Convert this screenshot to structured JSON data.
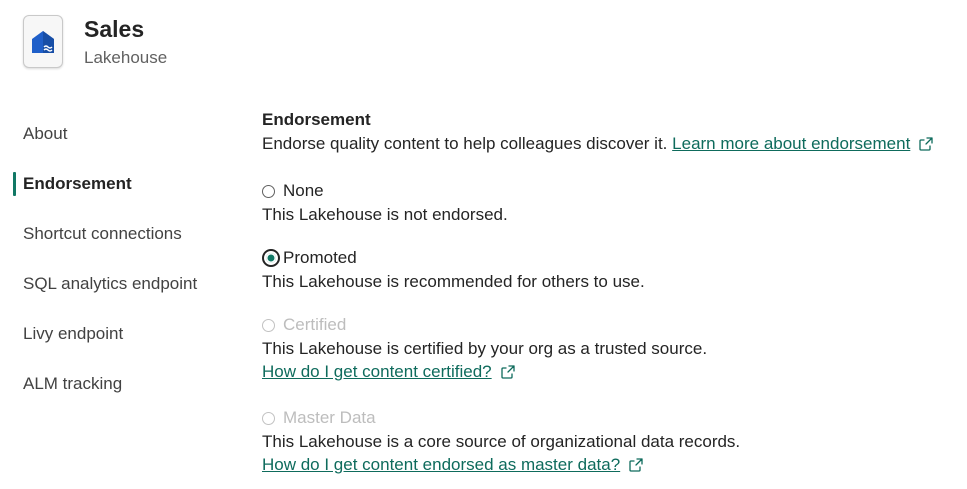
{
  "header": {
    "title": "Sales",
    "subtitle": "Lakehouse",
    "icon": "lakehouse-icon"
  },
  "nav": {
    "items": [
      {
        "label": "About",
        "active": false
      },
      {
        "label": "Endorsement",
        "active": true
      },
      {
        "label": "Shortcut connections",
        "active": false
      },
      {
        "label": "SQL analytics endpoint",
        "active": false
      },
      {
        "label": "Livy endpoint",
        "active": false
      },
      {
        "label": "ALM tracking",
        "active": false
      }
    ]
  },
  "endorsement": {
    "title": "Endorsement",
    "description": "Endorse quality content to help colleagues discover it.",
    "learn_more_link": "Learn more about endorsement",
    "options": [
      {
        "label": "None",
        "description": "This Lakehouse is not endorsed.",
        "selected": false,
        "disabled": false
      },
      {
        "label": "Promoted",
        "description": "This Lakehouse is recommended for others to use.",
        "selected": true,
        "disabled": false
      },
      {
        "label": "Certified",
        "description": "This Lakehouse is certified by your org as a trusted source.",
        "link": "How do I get content certified?",
        "selected": false,
        "disabled": true
      },
      {
        "label": "Master Data",
        "description": "This Lakehouse is a core source of organizational data records.",
        "link": "How do I get content endorsed as master data?",
        "selected": false,
        "disabled": true
      }
    ]
  },
  "colors": {
    "accent": "#117865",
    "link": "#0e6b5c",
    "icon_blue": "#1f5fc9"
  }
}
